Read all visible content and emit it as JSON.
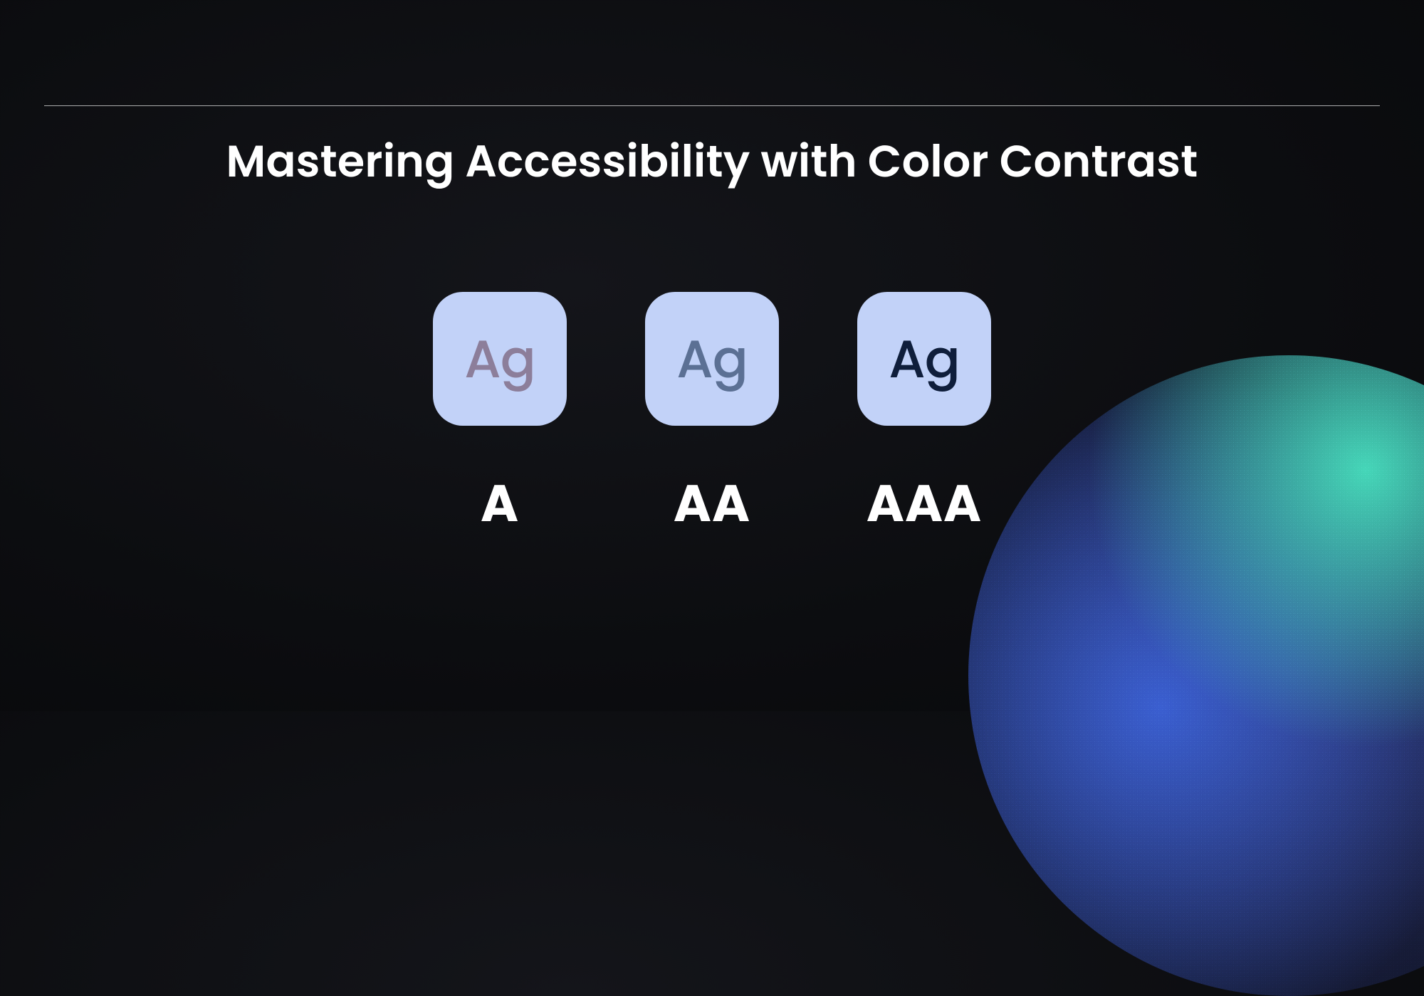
{
  "title": "Mastering Accessibility with Color Contrast",
  "sample_text": "Ag",
  "swatch_bg": "#C2D2F8",
  "swatches": [
    {
      "grade": "A",
      "text_color": "#8C7E9A"
    },
    {
      "grade": "AA",
      "text_color": "#5B7094"
    },
    {
      "grade": "AAA",
      "text_color": "#0F1E3B"
    }
  ]
}
